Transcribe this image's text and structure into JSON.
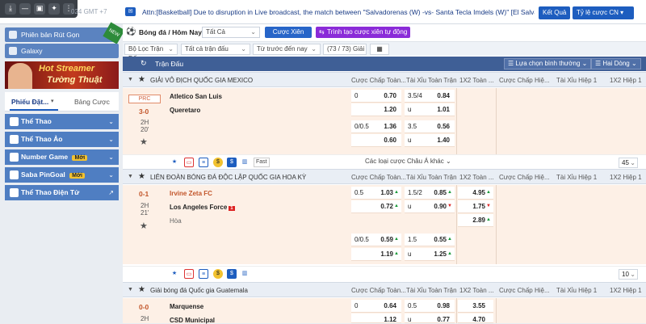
{
  "topbar": {
    "clock": "024 GMT +7",
    "ticker": "Attn:[Basketball] Due to disruption in Live broadcast, the match between \"Salvadorenas (W) -vs- Santa Tecla Imdels (W)\" [El Salvador",
    "results_btn": "Kết Quả",
    "odds_type": "Tỷ lệ cược CN"
  },
  "sidebar": {
    "promo_label": "Phiên bản Rút Gọn",
    "new_badge": "NEW",
    "galaxy": "Galaxy",
    "banner_line1": "Hot Streamer",
    "banner_line2": "Tường Thuật",
    "tab_bets": "Phiếu Đặt...",
    "tab_slip": "Bảng Cược",
    "badge_new": "Mới",
    "sports": [
      {
        "label": "Thể Thao"
      },
      {
        "label": "Thể Thao Ảo"
      },
      {
        "label": "Number Game"
      },
      {
        "label": "Saba PinGoal"
      },
      {
        "label": "Thể Thao Điện Tử"
      }
    ]
  },
  "main": {
    "sport_title": "Bóng đá / Hôm Nay",
    "market_select": "Tất Cả",
    "btn_parlay": "Cược Xiên",
    "btn_auto_parlay": "Trình tạo cược xiên tự động",
    "filter_league": "Bộ Lọc Trận Đấu",
    "filter_all": "Tất cả trận đấu",
    "filter_time": "Từ trước đến nay",
    "match_count": "(73 / 73) Giải",
    "header_label": "Trận Đấu",
    "sort_label": "Lựa chọn bình thường",
    "lines_label": "Hai Dòng",
    "columns": [
      "Cược Chấp Toàn...",
      "Tài Xỉu Toàn Trận",
      "1X2 Toàn ...",
      "Cược Chấp Hiệ...",
      "Tài Xỉu Hiệp 1",
      "1X2 Hiệp 1"
    ]
  },
  "leagues": [
    {
      "name": "GIẢI VÔ ĐỊCH QUỐC GIA MEXICO",
      "match": {
        "badge": "PRC",
        "score": "3-0",
        "period": "2H",
        "minute": "20'",
        "home": "Atletico San Luis",
        "away": "Queretaro",
        "hc1": [
          "0",
          "0.70",
          "",
          "1.20"
        ],
        "ou1": [
          "3.5/4",
          "0.84",
          "u",
          "1.01"
        ],
        "hc2": [
          "0/0.5",
          "1.36",
          "",
          "0.60"
        ],
        "ou2": [
          "3.5",
          "0.56",
          "u",
          "1.40"
        ],
        "fast": "Fast",
        "more": "Các loại cược Châu Á khác",
        "more_count": "45"
      }
    },
    {
      "name": "LIÊN ĐOÀN BÓNG ĐÁ ĐỘC LẬP QUỐC GIA HOA KỲ",
      "match": {
        "score": "0-1",
        "period": "2H",
        "minute": "21'",
        "home": "Irvine Zeta FC",
        "away": "Los Angeles Force",
        "red_cards": "1",
        "draw": "Hòa",
        "hc1": [
          "0.5",
          "1.03",
          "",
          "0.72"
        ],
        "ou1": [
          "1.5/2",
          "0.85",
          "u",
          "0.90"
        ],
        "x12": [
          "4.95",
          "1.75",
          "2.89"
        ],
        "hc2": [
          "0/0.5",
          "0.59",
          "",
          "1.19"
        ],
        "ou2": [
          "1.5",
          "0.55",
          "u",
          "1.25"
        ],
        "more_count": "10"
      }
    },
    {
      "name": "Giải bóng đá Quốc gia Guatemala",
      "match": {
        "score": "0-0",
        "period": "2H",
        "home": "Marquense",
        "away": "CSD Municipal",
        "hc1": [
          "0",
          "0.64",
          "",
          "1.12"
        ],
        "ou1": [
          "0.5",
          "0.98",
          "u",
          "0.77"
        ],
        "x12": [
          "3.55",
          "4.70"
        ]
      }
    }
  ]
}
